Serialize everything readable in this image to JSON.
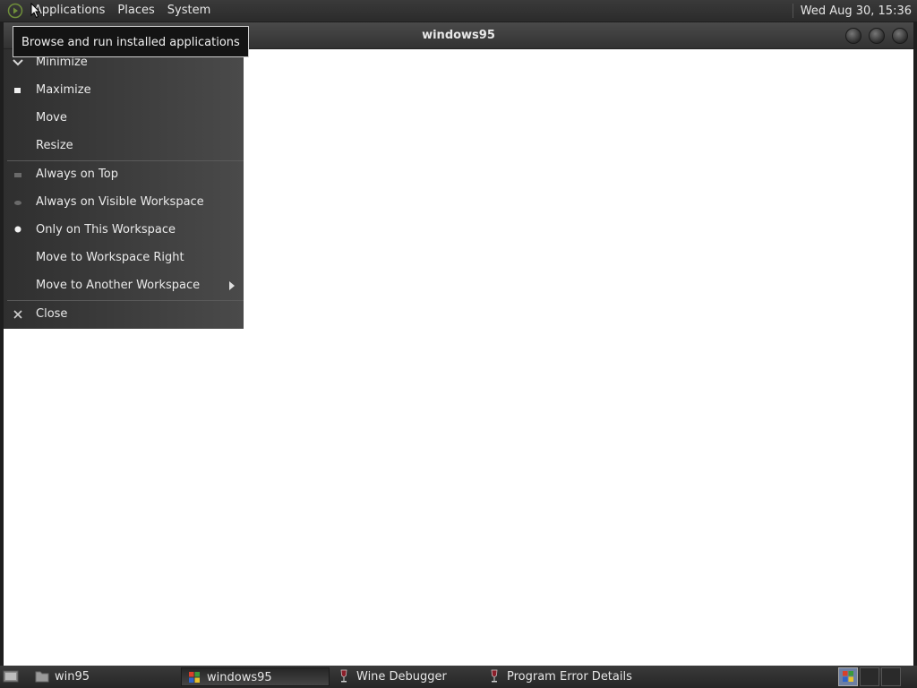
{
  "top_panel": {
    "menus": [
      "Applications",
      "Places",
      "System"
    ],
    "clock": "Wed Aug 30, 15:36"
  },
  "tooltip": "Browse and run installed applications",
  "window": {
    "title": "windows95"
  },
  "context_menu": {
    "items": [
      {
        "label": "Minimize",
        "icon": "minimize-icon"
      },
      {
        "label": "Maximize",
        "icon": "maximize-icon"
      },
      {
        "label": "Move",
        "icon": ""
      },
      {
        "label": "Resize",
        "icon": ""
      },
      {
        "label": "Always on Top",
        "icon": "checkbox-unchecked-icon"
      },
      {
        "label": "Always on Visible Workspace",
        "icon": "radio-unselected-icon"
      },
      {
        "label": "Only on This Workspace",
        "icon": "radio-selected-icon"
      },
      {
        "label": "Move to Workspace Right",
        "icon": ""
      },
      {
        "label": "Move to Another Workspace",
        "icon": "submenu-arrow-icon"
      },
      {
        "label": "Close",
        "icon": "close-icon"
      }
    ]
  },
  "taskbar": {
    "tasks": [
      {
        "label": "win95",
        "icon": "folder-icon"
      },
      {
        "label": "windows95",
        "icon": "windows-logo-icon"
      },
      {
        "label": "Wine Debugger",
        "icon": "wine-glass-icon"
      },
      {
        "label": "Program Error Details",
        "icon": "wine-glass-icon"
      }
    ]
  }
}
